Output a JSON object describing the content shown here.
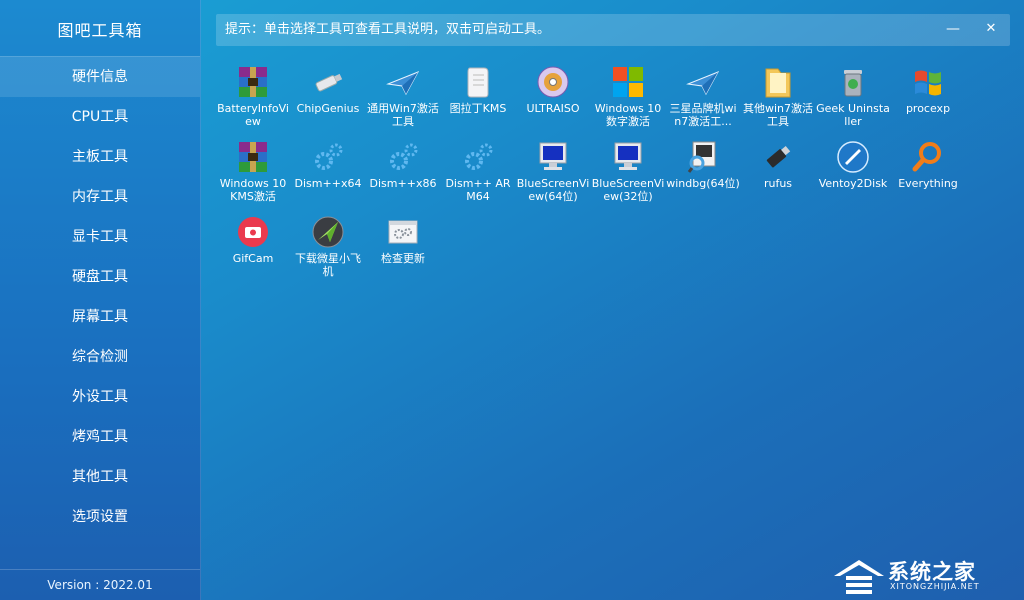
{
  "app": {
    "title": "图吧工具箱",
    "version": "Version : 2022.01"
  },
  "sidebar": {
    "items": [
      {
        "label": "硬件信息"
      },
      {
        "label": "CPU工具"
      },
      {
        "label": "主板工具"
      },
      {
        "label": "内存工具"
      },
      {
        "label": "显卡工具"
      },
      {
        "label": "硬盘工具"
      },
      {
        "label": "屏幕工具"
      },
      {
        "label": "综合检测"
      },
      {
        "label": "外设工具"
      },
      {
        "label": "烤鸡工具"
      },
      {
        "label": "其他工具"
      },
      {
        "label": "选项设置"
      }
    ]
  },
  "tipbar": {
    "text": "提示：单击选择工具可查看工具说明，双击可启动工具。",
    "minimize": "—",
    "close": "✕"
  },
  "tools": [
    {
      "label": "BatteryInfoView",
      "icon": "winrar-archive-icon"
    },
    {
      "label": "ChipGenius",
      "icon": "usb-drive-icon"
    },
    {
      "label": "通用Win7激活工具",
      "icon": "paper-plane-icon"
    },
    {
      "label": "图拉丁KMS",
      "icon": "scroll-icon"
    },
    {
      "label": "ULTRAISO",
      "icon": "disc-icon"
    },
    {
      "label": "Windows 10数字激活",
      "icon": "windows-logo-icon"
    },
    {
      "label": "三星品牌机win7激活工...",
      "icon": "paper-plane-icon"
    },
    {
      "label": "其他win7激活工具",
      "icon": "folder-icon"
    },
    {
      "label": "Geek Uninstaller",
      "icon": "trash-can-icon"
    },
    {
      "label": "procexp",
      "icon": "windows-flag-icon"
    },
    {
      "label": "Windows 10 KMS激活",
      "icon": "winrar-archive-icon"
    },
    {
      "label": "Dism++x64",
      "icon": "gears-icon"
    },
    {
      "label": "Dism++x86",
      "icon": "gears-icon"
    },
    {
      "label": "Dism++ ARM64",
      "icon": "gears-icon"
    },
    {
      "label": "BlueScreenView(64位)",
      "icon": "monitor-icon"
    },
    {
      "label": "BlueScreenView(32位)",
      "icon": "monitor-icon"
    },
    {
      "label": "windbg(64位)",
      "icon": "debugger-icon"
    },
    {
      "label": "rufus",
      "icon": "usb-stick-icon"
    },
    {
      "label": "Ventoy2Disk",
      "icon": "ventoy-icon"
    },
    {
      "label": "Everything",
      "icon": "magnifier-icon"
    },
    {
      "label": "GifCam",
      "icon": "camera-icon"
    },
    {
      "label": "下载微星小飞机",
      "icon": "afterburner-icon"
    },
    {
      "label": "检查更新",
      "icon": "settings-window-icon"
    }
  ],
  "watermark": {
    "text": "系统之家",
    "sub": "XITONGZHIJIA.NET"
  }
}
